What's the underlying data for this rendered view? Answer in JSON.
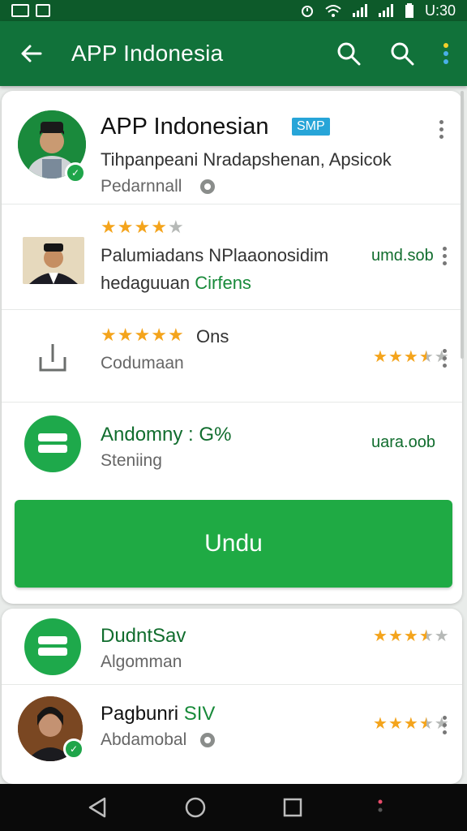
{
  "status_bar": {
    "time": "U:30"
  },
  "app_bar": {
    "title": "APP Indonesia"
  },
  "card1": {
    "header": {
      "title": "APP Indonesian",
      "tag": "SMP",
      "line2": "Tihpanpeani Nradapshenan, Apsicok",
      "line3": "Pedarnnall"
    },
    "item1": {
      "rating": 4,
      "line1": "Palumiadans NPlaaonosidim",
      "line2_prefix": "hedaguuan",
      "line2_accent": "Cirfens",
      "right_text": "umd.sob"
    },
    "item2": {
      "rating": 5,
      "rating_label": "Ons",
      "line2": "Codumaan",
      "right_rating": 3.5
    },
    "item3": {
      "title": "Andomny : G%",
      "subtitle": "Steniing",
      "right_text": "uara.oob"
    },
    "download_label": "Undu"
  },
  "card2": {
    "item1": {
      "title": "DudntSav",
      "subtitle": "Algomman",
      "right_rating": 3.5
    },
    "item2": {
      "title": "Pagbunri",
      "title_accent": "SIV",
      "subtitle": "Abdamobal",
      "right_rating": 3.5
    }
  },
  "colors": {
    "appbar": "#11723a",
    "statusbar": "#0d5a2a",
    "accent_green": "#1faa44",
    "star": "#f4a41c",
    "tag_blue": "#27a5d8"
  }
}
